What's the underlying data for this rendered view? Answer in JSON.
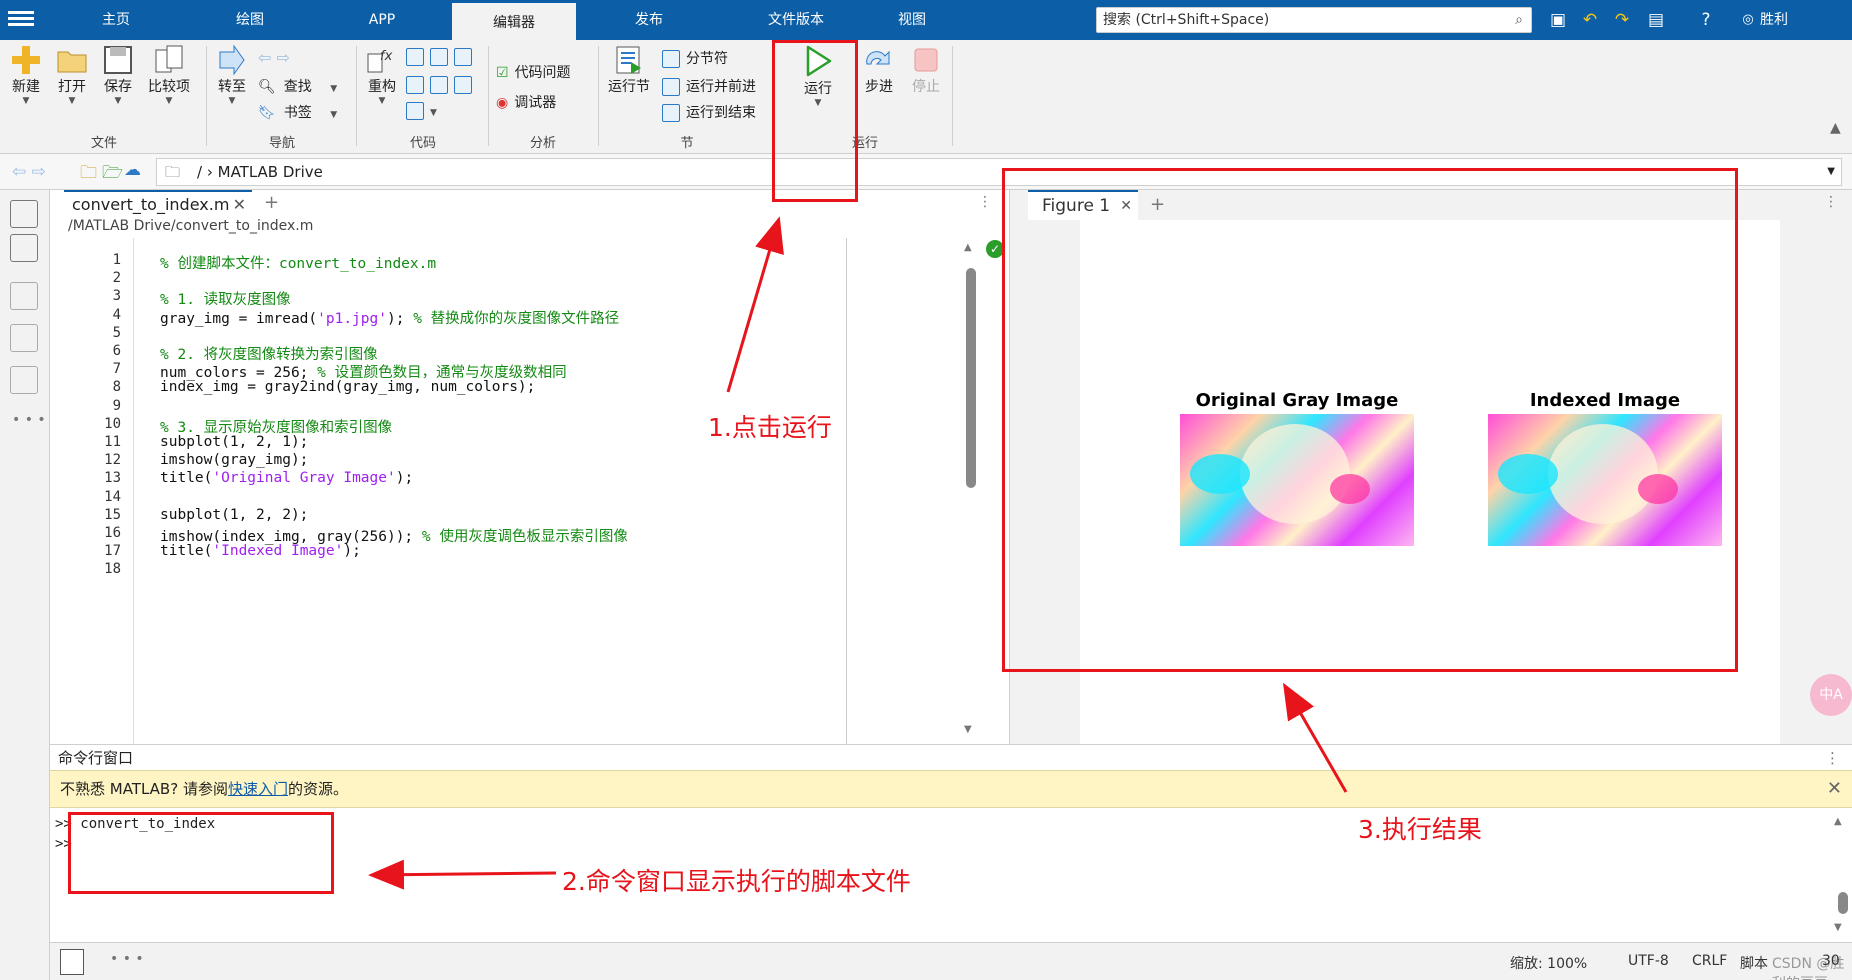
{
  "topbar": {
    "tabs": [
      "主页",
      "绘图",
      "APP",
      "编辑器",
      "发布",
      "文件版本",
      "视图"
    ],
    "active_tab": "编辑器",
    "search_placeholder": "搜索 (Ctrl+Shift+Space)",
    "user": "胜利"
  },
  "ribbon": {
    "file": {
      "new": "新建",
      "open": "打开",
      "save": "保存",
      "compare": "比较项",
      "section": "文件"
    },
    "nav": {
      "goto": "转至",
      "find": "查找",
      "bookmark": "书签",
      "section": "导航"
    },
    "code": {
      "refactor": "重构",
      "section": "代码"
    },
    "analyze": {
      "code_issues": "代码问题",
      "debugger": "调试器",
      "section": "分析"
    },
    "section_group": {
      "run_section": "运行节",
      "section_break": "分节符",
      "run_and_advance": "运行并前进",
      "run_to_end": "运行到结束",
      "section": "节"
    },
    "run": {
      "run": "运行",
      "step": "步进",
      "stop": "停止",
      "section": "运行"
    }
  },
  "pathbar": {
    "root": "/",
    "folder": "MATLAB Drive"
  },
  "editor": {
    "tab_name": "convert_to_index.m",
    "file_path": "/MATLAB Drive/convert_to_index.m",
    "lines": [
      {
        "n": "1",
        "segs": [
          {
            "t": "% 创建脚本文件：convert_to_index.m",
            "c": "cmt"
          }
        ]
      },
      {
        "n": "2",
        "segs": []
      },
      {
        "n": "3",
        "segs": [
          {
            "t": "% 1. 读取灰度图像",
            "c": "cmt"
          }
        ]
      },
      {
        "n": "4",
        "segs": [
          {
            "t": "gray_img = imread(",
            "c": ""
          },
          {
            "t": "'p1.jpg'",
            "c": "str"
          },
          {
            "t": "); ",
            "c": ""
          },
          {
            "t": "% 替换成你的灰度图像文件路径",
            "c": "cmt"
          }
        ]
      },
      {
        "n": "5",
        "segs": []
      },
      {
        "n": "6",
        "segs": [
          {
            "t": "% 2. 将灰度图像转换为索引图像",
            "c": "cmt"
          }
        ]
      },
      {
        "n": "7",
        "segs": [
          {
            "t": "num_colors = 256; ",
            "c": ""
          },
          {
            "t": "% 设置颜色数目，通常与灰度级数相同",
            "c": "cmt"
          }
        ]
      },
      {
        "n": "8",
        "segs": [
          {
            "t": "index_img = gray2ind(gray_img, num_colors);",
            "c": ""
          }
        ]
      },
      {
        "n": "9",
        "segs": []
      },
      {
        "n": "10",
        "segs": [
          {
            "t": "% 3. 显示原始灰度图像和索引图像",
            "c": "cmt"
          }
        ]
      },
      {
        "n": "11",
        "segs": [
          {
            "t": "subplot(1, 2, 1);",
            "c": ""
          }
        ]
      },
      {
        "n": "12",
        "segs": [
          {
            "t": "imshow(gray_img);",
            "c": ""
          }
        ]
      },
      {
        "n": "13",
        "segs": [
          {
            "t": "title(",
            "c": ""
          },
          {
            "t": "'Original Gray Image'",
            "c": "str"
          },
          {
            "t": ");",
            "c": ""
          }
        ]
      },
      {
        "n": "14",
        "segs": []
      },
      {
        "n": "15",
        "segs": [
          {
            "t": "subplot(1, 2, 2);",
            "c": ""
          }
        ]
      },
      {
        "n": "16",
        "segs": [
          {
            "t": "imshow(index_img, gray(256)); ",
            "c": ""
          },
          {
            "t": "% 使用灰度调色板显示索引图像",
            "c": "cmt"
          }
        ]
      },
      {
        "n": "17",
        "segs": [
          {
            "t": "title(",
            "c": ""
          },
          {
            "t": "'Indexed Image'",
            "c": "str"
          },
          {
            "t": ");",
            "c": ""
          }
        ]
      },
      {
        "n": "18",
        "segs": []
      }
    ]
  },
  "figure": {
    "tab_name": "Figure 1",
    "left_title": "Original Gray Image",
    "right_title": "Indexed Image"
  },
  "command_window": {
    "title": "命令行窗口",
    "info_prefix": "不熟悉 MATLAB? 请参阅",
    "info_link": "快速入门",
    "info_suffix": "的资源。",
    "prompt": ">>",
    "command": "convert_to_index"
  },
  "status": {
    "zoom": "缩放: 100%",
    "encoding": "UTF-8",
    "eol": "CRLF",
    "script": "脚本",
    "watermark": "CSDN @胜利的豆豆",
    "col": "30"
  },
  "annotations": {
    "step1": "1.点击运行",
    "step2": "2.命令窗口显示执行的脚本文件",
    "step3": "3.执行结果"
  },
  "colors": {
    "accent": "#0c5fa6",
    "annotation_red": "#e8141c",
    "comment_green": "#138a13",
    "string_purple": "#a020f0",
    "run_green": "#2a9d2a"
  }
}
